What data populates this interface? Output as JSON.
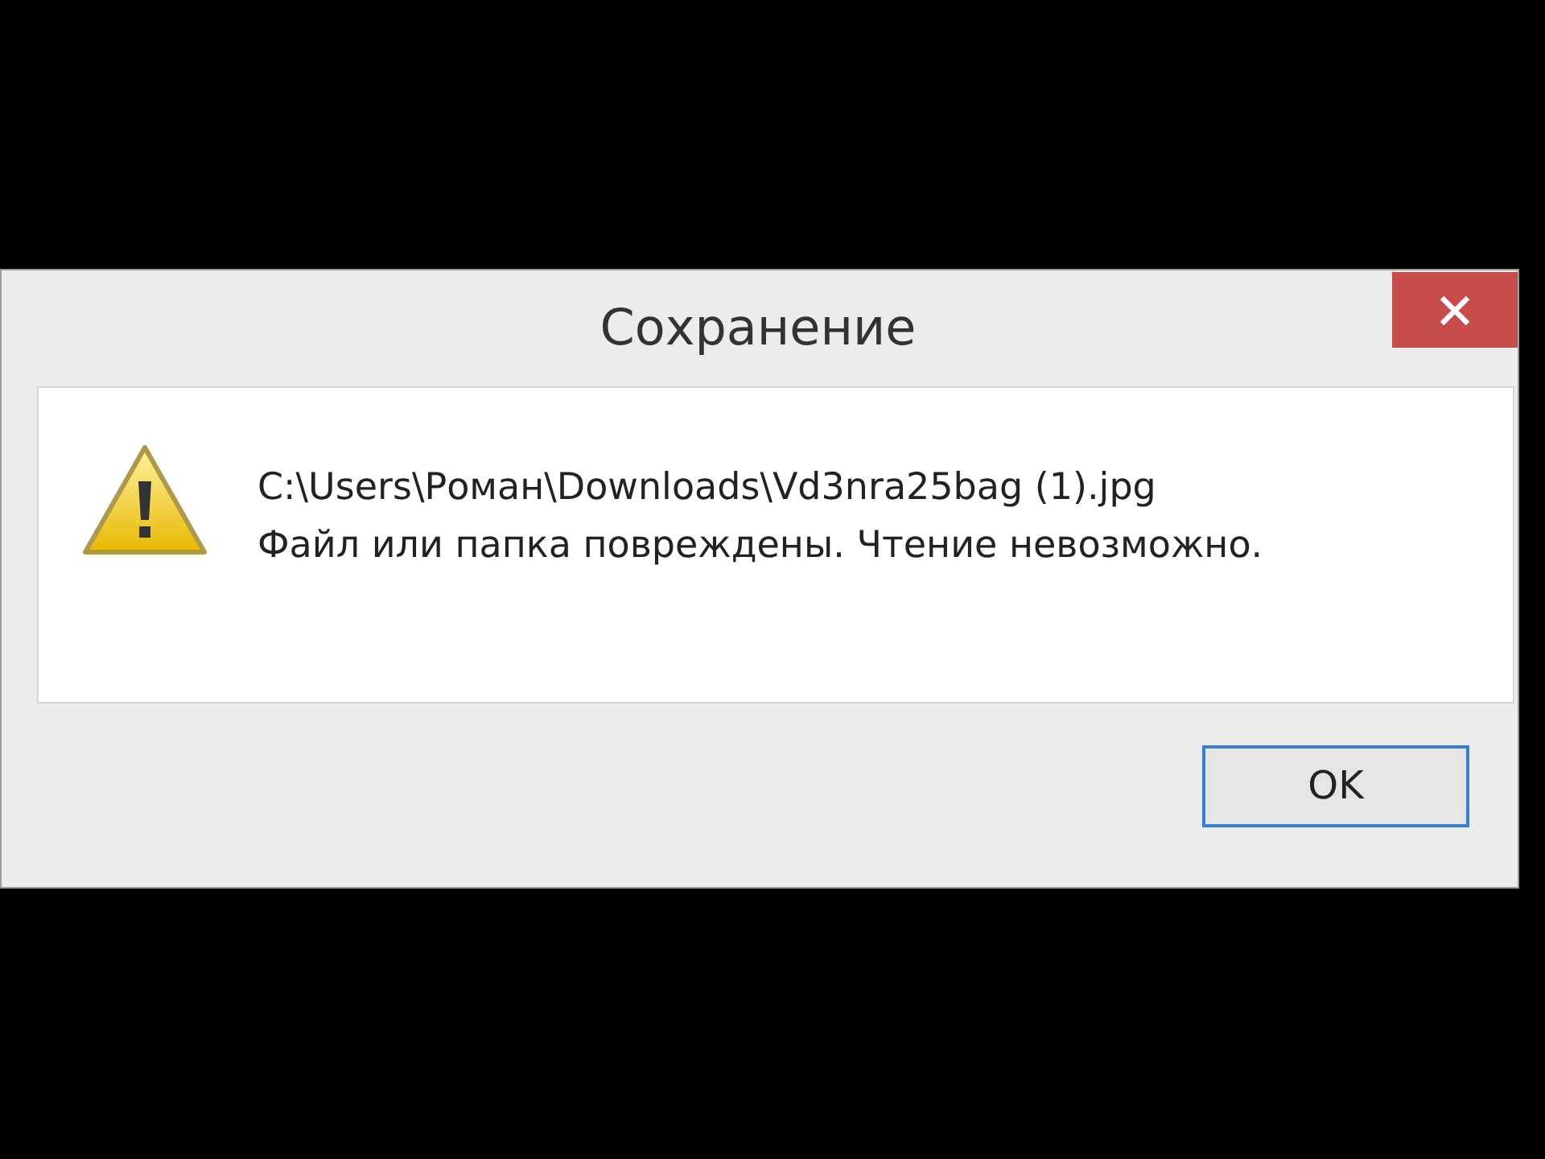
{
  "window": {
    "title": "Сохранение"
  },
  "message": {
    "path": "C:\\Users\\Роман\\Downloads\\Vd3nra25bag (1).jpg",
    "text": "Файл или папка повреждены. Чтение невозможно."
  },
  "buttons": [
    "OK"
  ]
}
